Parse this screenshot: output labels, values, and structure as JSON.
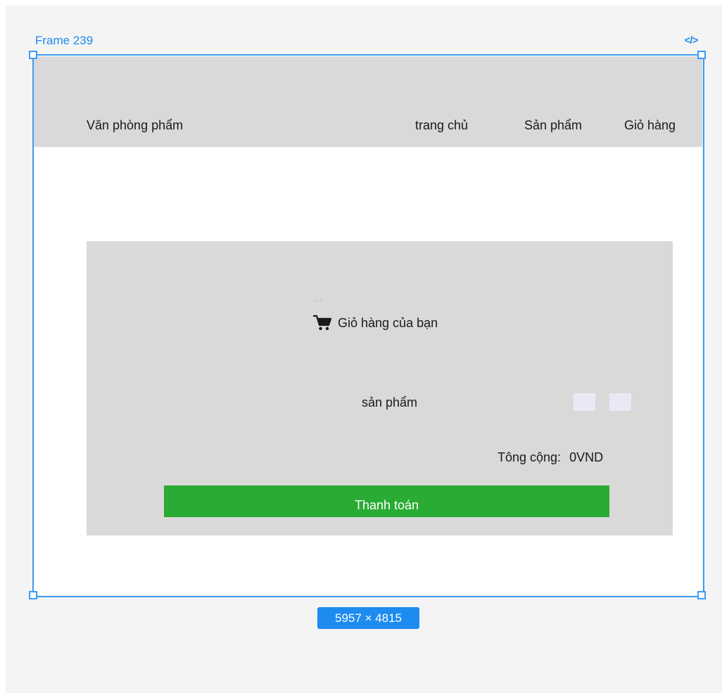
{
  "editor": {
    "frame_name": "Frame 239",
    "code_icon": "code-icon",
    "frame_size": "5957 × 4815",
    "accent_color": "#1e8bf0"
  },
  "nav": {
    "brand": "Văn phòng phẩm",
    "links": [
      "trang chủ",
      "Sản phẩm",
      "Giỏ hàng"
    ],
    "background": "#d9d9d9"
  },
  "cart": {
    "dots": "...",
    "icon": "shopping-cart-icon",
    "title": "Giỏ hàng của bạn",
    "product_label": "sản phẩm",
    "total_label": "Tông cộng:",
    "total_value": "0VND",
    "checkout_label": "Thanh toán",
    "checkout_color": "#2aab34"
  }
}
